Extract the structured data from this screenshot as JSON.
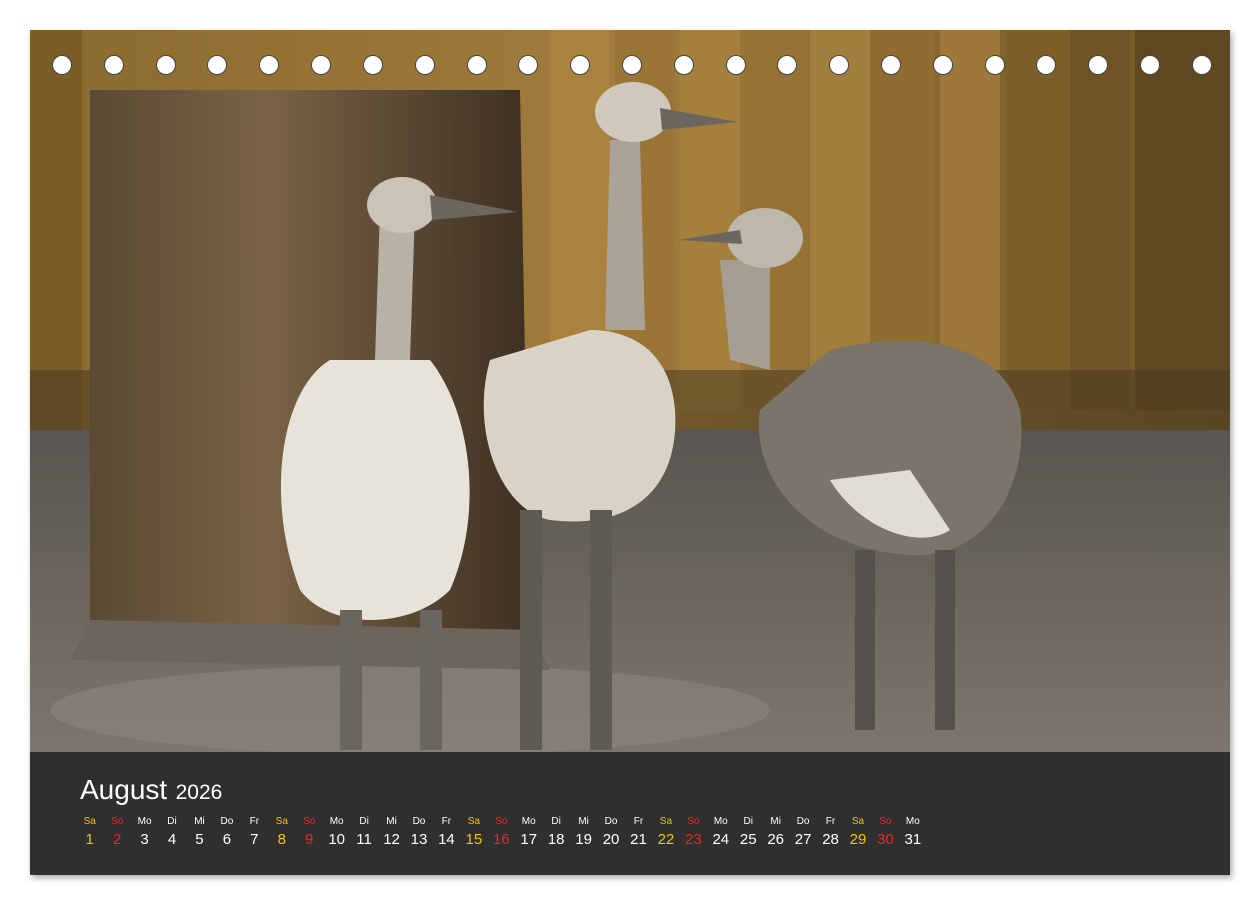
{
  "calendar": {
    "month": "August",
    "year": "2026",
    "colors": {
      "text": "#ffffff",
      "saturday": "#f2c500",
      "sunday": "#e52a2a",
      "panel": "#2f2f2f"
    },
    "days": [
      {
        "name": "Sa",
        "num": "1",
        "type": "sat"
      },
      {
        "name": "So",
        "num": "2",
        "type": "sun"
      },
      {
        "name": "Mo",
        "num": "3",
        "type": "wd"
      },
      {
        "name": "Di",
        "num": "4",
        "type": "wd"
      },
      {
        "name": "Mi",
        "num": "5",
        "type": "wd"
      },
      {
        "name": "Do",
        "num": "6",
        "type": "wd"
      },
      {
        "name": "Fr",
        "num": "7",
        "type": "wd"
      },
      {
        "name": "Sa",
        "num": "8",
        "type": "sat"
      },
      {
        "name": "So",
        "num": "9",
        "type": "sun"
      },
      {
        "name": "Mo",
        "num": "10",
        "type": "wd"
      },
      {
        "name": "Di",
        "num": "11",
        "type": "wd"
      },
      {
        "name": "Mi",
        "num": "12",
        "type": "wd"
      },
      {
        "name": "Do",
        "num": "13",
        "type": "wd"
      },
      {
        "name": "Fr",
        "num": "14",
        "type": "wd"
      },
      {
        "name": "Sa",
        "num": "15",
        "type": "sat"
      },
      {
        "name": "So",
        "num": "16",
        "type": "sun"
      },
      {
        "name": "Mo",
        "num": "17",
        "type": "wd"
      },
      {
        "name": "Di",
        "num": "18",
        "type": "wd"
      },
      {
        "name": "Mi",
        "num": "19",
        "type": "wd"
      },
      {
        "name": "Do",
        "num": "20",
        "type": "wd"
      },
      {
        "name": "Fr",
        "num": "21",
        "type": "wd"
      },
      {
        "name": "Sa",
        "num": "22",
        "type": "sat"
      },
      {
        "name": "So",
        "num": "23",
        "type": "sun"
      },
      {
        "name": "Mo",
        "num": "24",
        "type": "wd"
      },
      {
        "name": "Di",
        "num": "25",
        "type": "wd"
      },
      {
        "name": "Mi",
        "num": "26",
        "type": "wd"
      },
      {
        "name": "Do",
        "num": "27",
        "type": "wd"
      },
      {
        "name": "Fr",
        "num": "28",
        "type": "wd"
      },
      {
        "name": "Sa",
        "num": "29",
        "type": "sat"
      },
      {
        "name": "So",
        "num": "30",
        "type": "sun"
      },
      {
        "name": "Mo",
        "num": "31",
        "type": "wd"
      }
    ]
  },
  "binding": {
    "hole_count": 23
  }
}
